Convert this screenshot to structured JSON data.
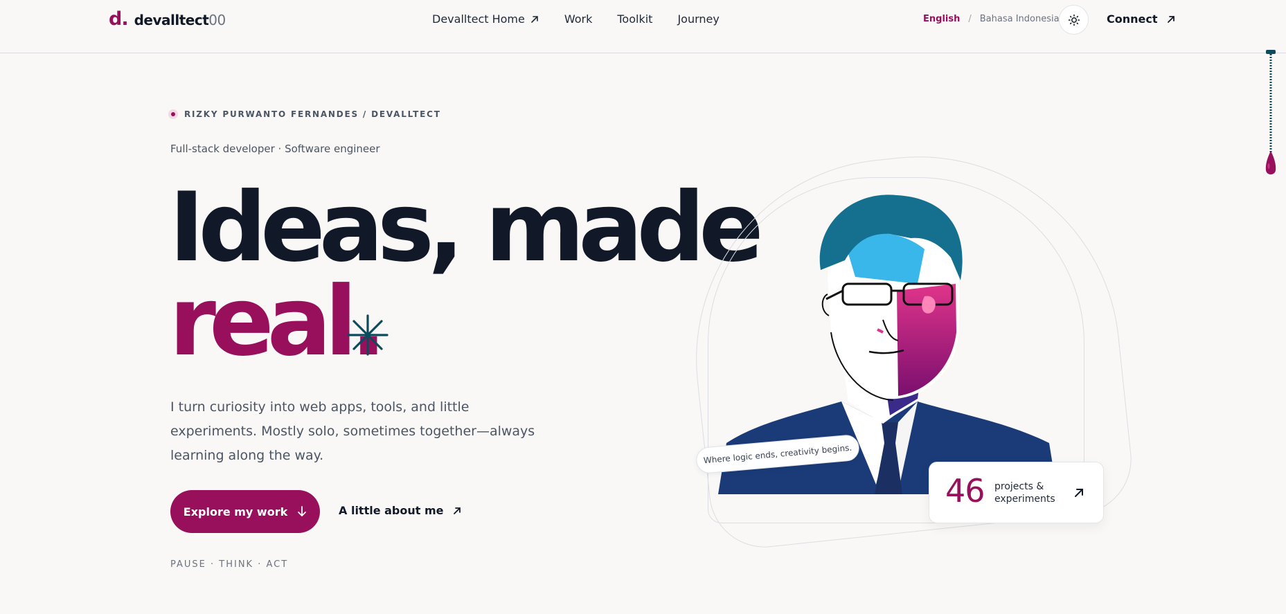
{
  "brand": {
    "mark": "d.",
    "name": "devalltect",
    "suffix": "00"
  },
  "nav": [
    {
      "label": "Devalltect Home",
      "external": true
    },
    {
      "label": "Work"
    },
    {
      "label": "Toolkit"
    },
    {
      "label": "Journey"
    }
  ],
  "language": {
    "active": "English",
    "separator": "/",
    "other": "Bahasa Indonesia"
  },
  "theme_toggle": {
    "icon": "sun-icon"
  },
  "connect": {
    "label": "Connect",
    "icon": "arrow-up-right-icon"
  },
  "hero": {
    "eyebrow": "RIZKY PURWANTO FERNANDES / DEVALLTECT",
    "role": "Full-stack developer · Software engineer",
    "headline_line1": "Ideas, made",
    "headline_line2": "real.",
    "tagline": "I turn curiosity into web apps, tools, and little experiments. Mostly solo, sometimes together—always learning along the way.",
    "primary_cta": "Explore my work",
    "secondary_cta": "A little about me",
    "motto": "PAUSE · THINK · ACT"
  },
  "portrait": {
    "quote": "Where logic ends, creativity begins."
  },
  "stat": {
    "number": "46",
    "label": "projects & experiments"
  },
  "colors": {
    "accent": "#98105c",
    "ink": "#111827",
    "muted": "#4b5563",
    "background": "#f9f8f6",
    "sparkle": "#0d4a5c"
  }
}
